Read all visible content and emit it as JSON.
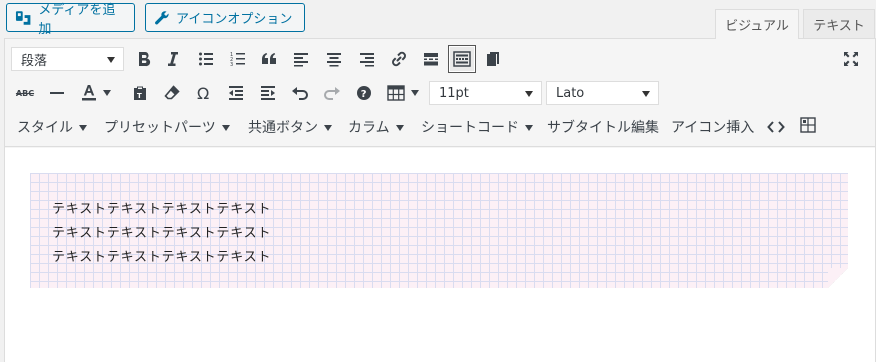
{
  "media_buttons": {
    "add_media": "メディアを追加",
    "icon_option": "アイコンオプション"
  },
  "tabs": {
    "visual": "ビジュアル",
    "text": "テキスト"
  },
  "toolbar": {
    "format_select": "段落",
    "font_size_select": "11pt",
    "font_family_select": "Lato",
    "menus": {
      "style": "スタイル",
      "preset_parts": "プリセットパーツ",
      "common_button": "共通ボタン",
      "column": "カラム",
      "shortcode": "ショートコード",
      "subtitle_edit": "サブタイトル編集",
      "icon_insert": "アイコン挿入"
    },
    "strike_label": "ABC",
    "icons": [
      "bold-icon",
      "italic-icon",
      "bullet-list-icon",
      "numbered-list-icon",
      "blockquote-icon",
      "align-left-icon",
      "align-center-icon",
      "align-right-icon",
      "link-icon",
      "read-more-icon",
      "toolbar-toggle-icon",
      "copy-icon",
      "fullscreen-icon",
      "strikethrough-icon",
      "horizontal-rule-icon",
      "text-color-icon",
      "paste-text-icon",
      "clear-formatting-icon",
      "special-character-icon",
      "outdent-icon",
      "indent-icon",
      "undo-icon",
      "redo-icon",
      "help-icon",
      "table-icon",
      "code-icon",
      "insert-box-icon"
    ]
  },
  "content": {
    "lines": [
      "テキストテキストテキストテキスト",
      "テキストテキストテキストテキスト",
      "テキストテキストテキストテキスト"
    ]
  },
  "colors": {
    "accent": "#0071a1",
    "grid_bg": "#fcf0f6",
    "grid_line": "#d9dcf0"
  }
}
